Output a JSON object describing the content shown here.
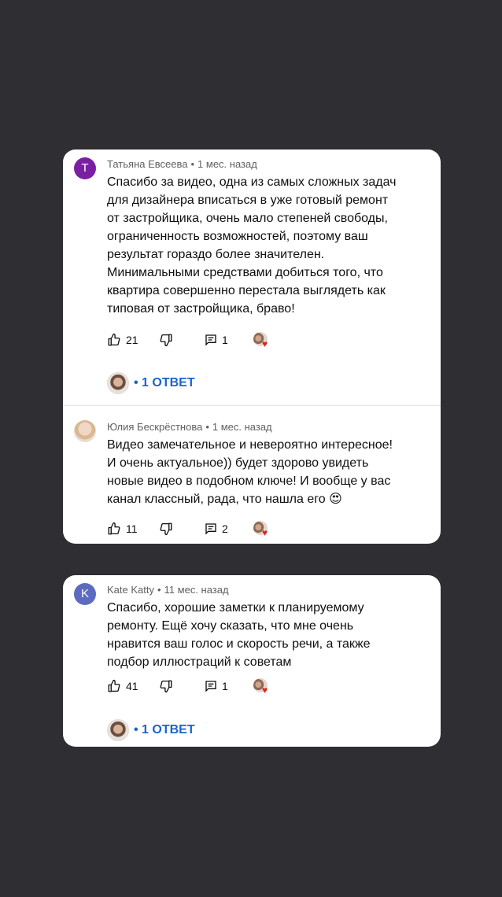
{
  "cards": [
    {
      "comments": [
        {
          "avatar_letter": "T",
          "avatar_color": "#7b1fa2",
          "author": "Татьяна Евсеева",
          "time": "1 мес. назад",
          "text_lines": [
            "Спасибо за видео, одна из самых сложных задач",
            "для дизайнера вписаться в уже готовый ремонт",
            "от застройщика, очень мало степеней свободы,",
            "ограниченность возможностей, поэтому  ваш",
            "результат гораздо более значителен.",
            "Минимальными средствами добиться того, что",
            "квартира совершенно перестала выглядеть как",
            "типовая от застройщика, браво!"
          ],
          "likes": "21",
          "replies_count": "1",
          "replies_label": "• 1 ОТВЕТ"
        },
        {
          "avatar_letter": "",
          "author": "Юлия Бескрёстнова",
          "time": "1 мес. назад",
          "text_lines": [
            "Видео замечательное и невероятно интересное!",
            "И очень актуальное)) будет здорово увидеть",
            "новые видео в подобном ключе! И вообще у вас",
            "канал классный, рада, что нашла его 😍"
          ],
          "likes": "11",
          "replies_count": "2"
        }
      ]
    },
    {
      "comments": [
        {
          "avatar_letter": "K",
          "avatar_color": "#5c6bc0",
          "author": "Kate Katty",
          "time": "11 мес. назад",
          "text_lines": [
            "Спасибо, хорошие заметки к планируемому",
            "ремонту. Ещё хочу сказать, что мне очень",
            "нравится ваш голос и скорость речи, а также",
            "подбор иллюстраций к советам"
          ],
          "likes": "41",
          "replies_count": "1",
          "replies_label": "• 1 ОТВЕТ"
        }
      ]
    }
  ],
  "icons": {
    "like": "thumbs-up-icon",
    "dislike": "thumbs-down-icon",
    "reply": "comment-icon",
    "heart": "heart-icon"
  },
  "colors": {
    "background": "#2f2e33",
    "link": "#1b64c9",
    "heart": "#e0241b"
  }
}
